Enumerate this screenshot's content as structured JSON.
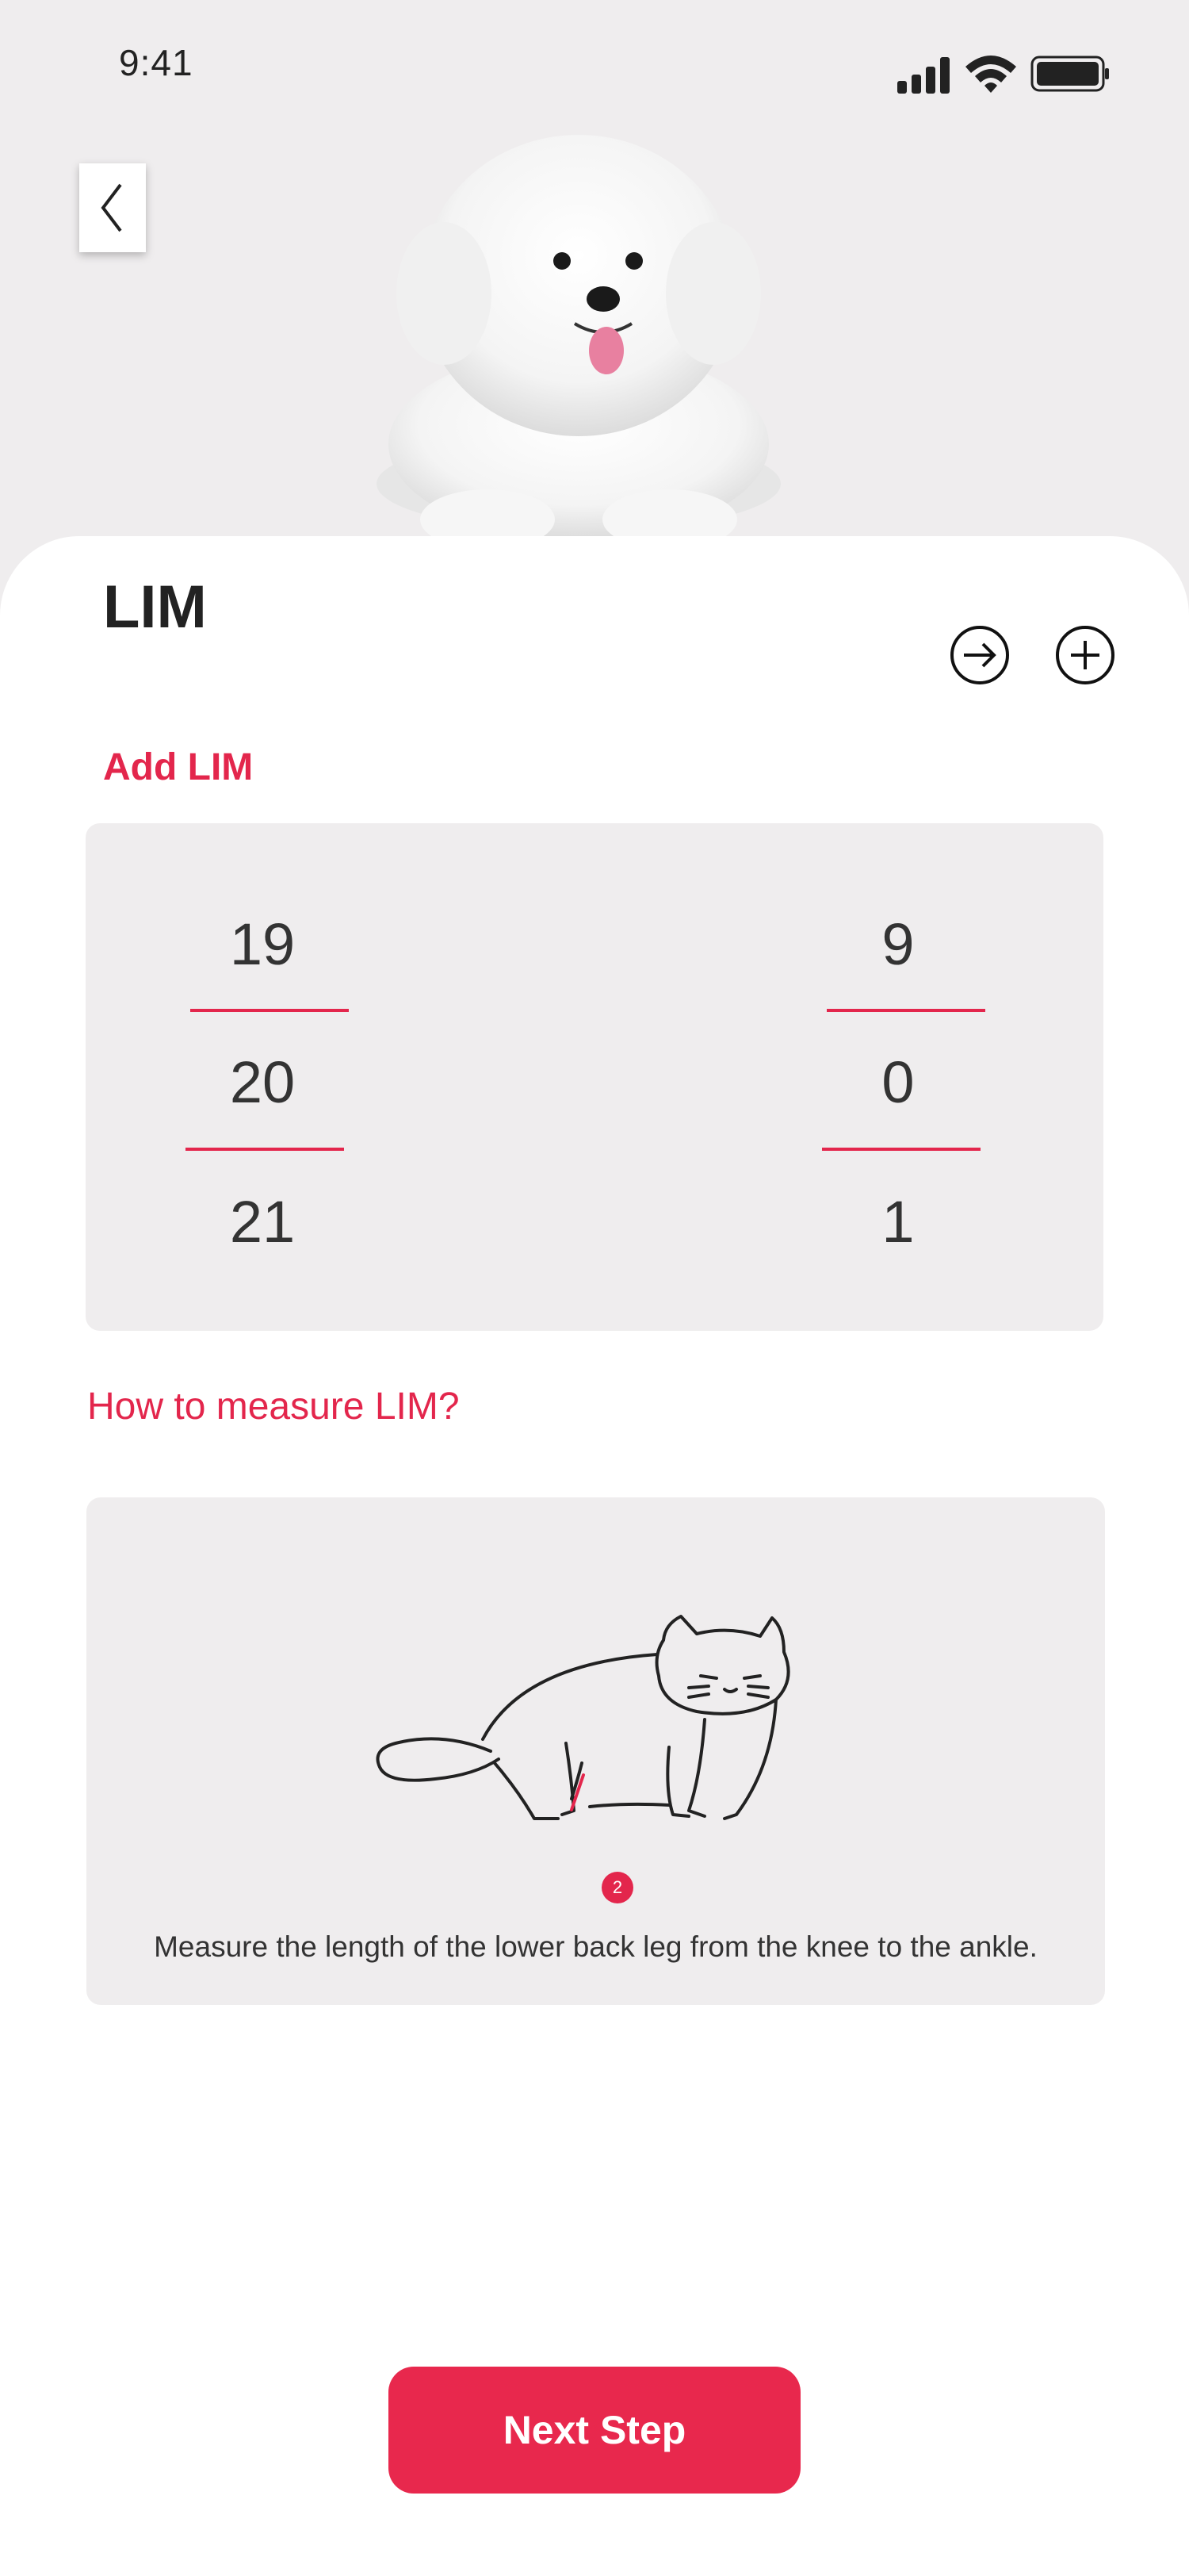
{
  "status_bar": {
    "time": "9:41",
    "icons": [
      "signal-icon",
      "wifi-icon",
      "battery-icon"
    ]
  },
  "header": {
    "back_icon": "chevron-left-icon",
    "title": "LIM",
    "actions": [
      "arrow-right-circle-icon",
      "plus-circle-icon"
    ]
  },
  "picker": {
    "label": "Add LIM",
    "whole_values": [
      "19",
      "20",
      "21"
    ],
    "decimal_values": [
      "9",
      "0",
      "1"
    ],
    "accent_color": "#e3264c"
  },
  "guide": {
    "link": "How to measure LIM?",
    "marker": "2",
    "description": "Measure the length of the lower back leg from the knee to the ankle."
  },
  "footer": {
    "next_label": "Next Step",
    "button_color": "#e8284d"
  }
}
